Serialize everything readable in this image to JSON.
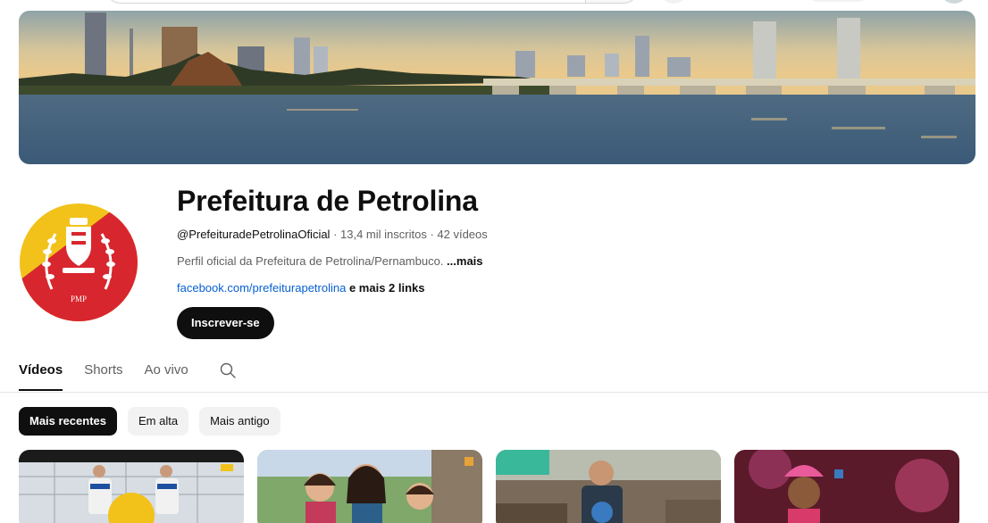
{
  "channel": {
    "title": "Prefeitura de Petrolina",
    "handle": "@PrefeituradePetrolinaOficial",
    "stats_sep1": " · ",
    "subscribers": "13,4 mil inscritos",
    "stats_sep2": " · ",
    "videos_count": "42 vídeos",
    "description": "Perfil oficial da Prefeitura de Petrolina/Pernambuco. ",
    "description_more": "...mais",
    "link": "facebook.com/prefeiturapetrolina",
    "more_links": " e mais 2 links",
    "subscribe_label": "Inscrever-se",
    "avatar_monogram": "PMP"
  },
  "tabs": [
    {
      "label": "Vídeos",
      "active": true
    },
    {
      "label": "Shorts",
      "active": false
    },
    {
      "label": "Ao vivo",
      "active": false
    }
  ],
  "chips": [
    {
      "label": "Mais recentes",
      "active": true
    },
    {
      "label": "Em alta",
      "active": false
    },
    {
      "label": "Mais antigo",
      "active": false
    }
  ],
  "colors": {
    "accent_blue_link": "#065fd4",
    "subscribe_bg": "#0f0f0f",
    "avatar_red": "#d8262e",
    "avatar_yellow": "#f2c21b",
    "avatar_green": "#3a9b3a",
    "avatar_navy": "#1e3a78"
  },
  "icons": {
    "tab_search": "search-icon"
  }
}
